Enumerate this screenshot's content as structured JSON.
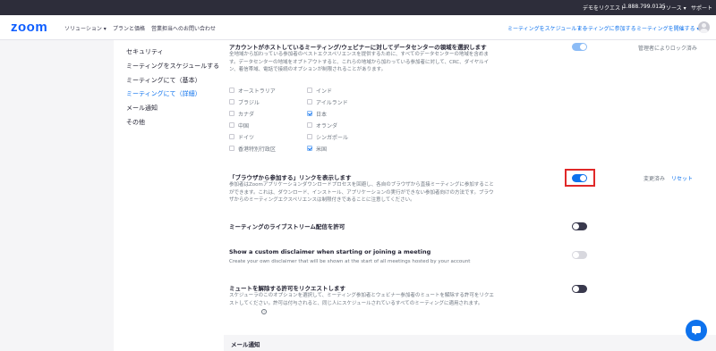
{
  "topbar": {
    "demo": "デモをリクエスト",
    "phone": "1.888.799.0125",
    "resources": "リソース ▾",
    "support": "サポート"
  },
  "navbar": {
    "logo": "zoom",
    "links": [
      "ソリューション ▾",
      "プランと価格",
      "営業担当へのお問い合わせ"
    ],
    "schedule": "ミーティングをスケジュールする",
    "join": "ミーティングに参加する",
    "host": "ミーティングを開催する ▾"
  },
  "sidebar": {
    "items": [
      "セキュリティ",
      "ミーティングをスケジュールする",
      "ミーティングにて（基本）",
      "ミーティングにて（詳細）",
      "メール通知",
      "その他"
    ]
  },
  "datacenter": {
    "title": "アカウントがホストしているミーティング/ウェビナーに対してデータセンターの領域を選択します",
    "desc": "全地域から加わっている参加者のベストエクスペリエンスを提供するために、すべてのデータセンターの地域を含めます。データセンターの地域をオプトアウトすると、これらの地域から加わっている参加者に対して、CRC、ダイヤルイン、着信帯域、電話で接続のオプションが制限されることがあります。",
    "lock_note": "管理者によりロック済み",
    "regions": [
      {
        "name": "オーストラリア",
        "checked": false
      },
      {
        "name": "インド",
        "checked": false
      },
      {
        "name": "ブラジル",
        "checked": false
      },
      {
        "name": "アイルランド",
        "checked": false
      },
      {
        "name": "カナダ",
        "checked": false
      },
      {
        "name": "日本",
        "checked": true
      },
      {
        "name": "中国",
        "checked": false
      },
      {
        "name": "オランダ",
        "checked": false
      },
      {
        "name": "ドイツ",
        "checked": false
      },
      {
        "name": "シンガポール",
        "checked": false
      },
      {
        "name": "香港特別行政区",
        "checked": false
      },
      {
        "name": "米国",
        "checked": true
      }
    ]
  },
  "browser_join": {
    "title": "「ブラウザから参加する」リンクを表示します",
    "desc": "参加者はZoomアプリケーションダウンロードプロセスを回避し、各自のブラウザから直接ミーティングに参加することができます。これは、ダウンロード、インストール、アプリケーションの実行ができない参加者向けの方法です。ブラウザからのミーティングエクスペリエンスは制限付きであることに注意してください。",
    "modified": "変更済み",
    "reset": "リセット"
  },
  "livestream": {
    "title": "ミーティングのライブストリーム配信を許可"
  },
  "disclaimer": {
    "title": "Show a custom disclaimer when starting or joining a meeting",
    "desc": "Create your own disclaimer that will be shown at the start of all meetings hosted by your account"
  },
  "unmute": {
    "title": "ミュートを解除する許可をリクエストします",
    "desc": "スケジューラのこのオプションを選択して、ミーティング参加者とウェビナー参加者のミュートを解除する許可をリクエストしてください。許可は付与されると、同じ人にスケジュールされているすべてのミーティングに適用されます。"
  },
  "bottom": {
    "section": "メール通知"
  },
  "colors": {
    "brand": "#0b5cff",
    "accent": "#0e72ed",
    "highlight": "#e02828"
  }
}
